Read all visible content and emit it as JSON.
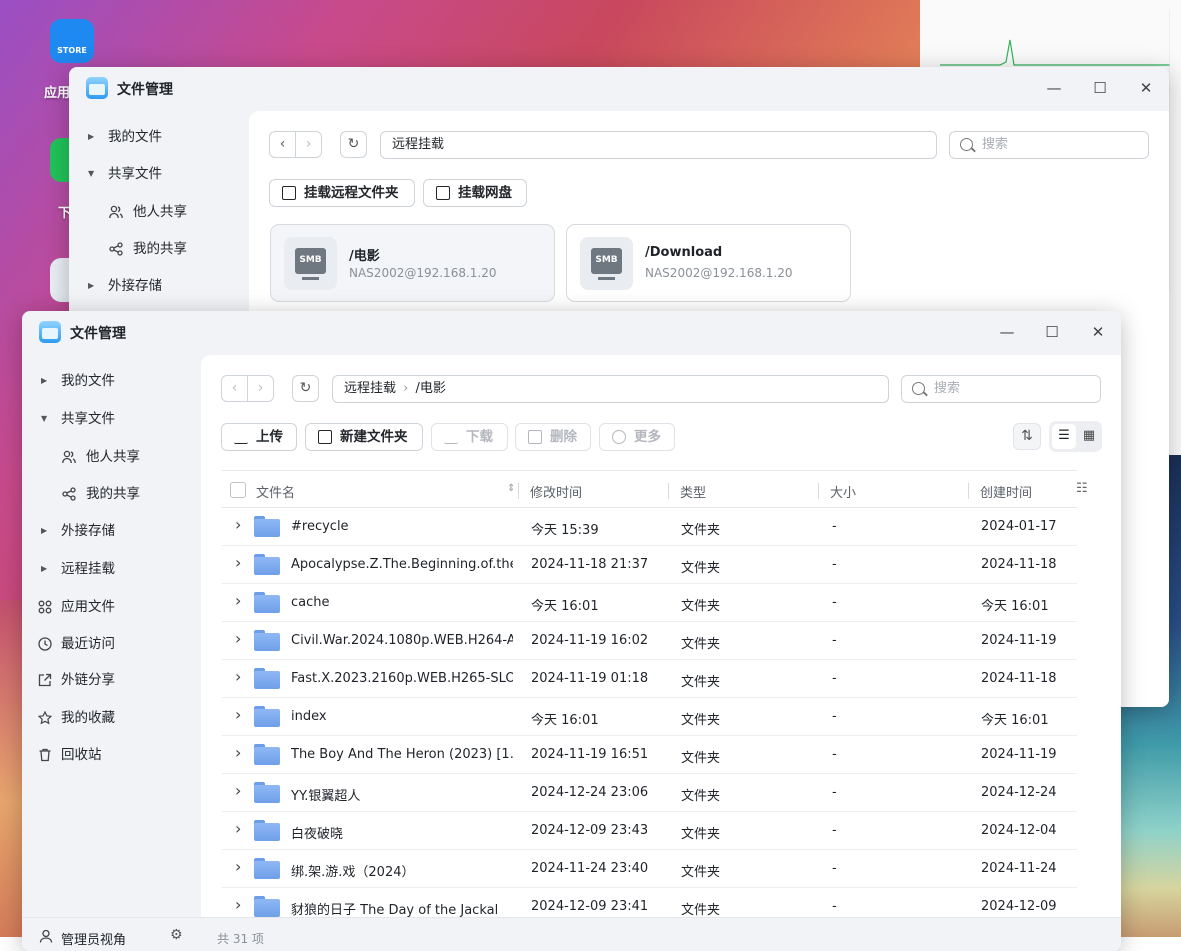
{
  "desktop": {
    "store_icon_text": "STORE",
    "label_apps": "应用",
    "label_download": "下"
  },
  "back_window": {
    "title": "文件管理",
    "sidebar": [
      {
        "label": "我的文件",
        "type": "top"
      },
      {
        "label": "共享文件",
        "type": "top"
      },
      {
        "label": "他人共享",
        "type": "sub"
      },
      {
        "label": "我的共享",
        "type": "sub"
      },
      {
        "label": "外接存储",
        "type": "top"
      }
    ],
    "address": "远程挂载",
    "search_placeholder": "搜索",
    "buttons": {
      "mount_folder": "挂载远程文件夹",
      "mount_disk": "挂载网盘"
    },
    "cards": [
      {
        "icon_text": "SMB",
        "name": "/电影",
        "host": "NAS2002@192.168.1.20"
      },
      {
        "icon_text": "SMB",
        "name": "/Download",
        "host": "NAS2002@192.168.1.20"
      }
    ]
  },
  "front_window": {
    "title": "文件管理",
    "sidebar": [
      {
        "label": "我的文件"
      },
      {
        "label": "共享文件"
      },
      {
        "label": "他人共享"
      },
      {
        "label": "我的共享"
      },
      {
        "label": "外接存储"
      },
      {
        "label": "远程挂载"
      },
      {
        "label": "应用文件"
      },
      {
        "label": "最近访问"
      },
      {
        "label": "外链分享"
      },
      {
        "label": "我的收藏"
      },
      {
        "label": "回收站"
      }
    ],
    "breadcrumb": [
      "远程挂载",
      "/电影"
    ],
    "search_placeholder": "搜索",
    "toolbar": {
      "upload": "上传",
      "new_folder": "新建文件夹",
      "download": "下载",
      "delete": "删除",
      "more": "更多"
    },
    "columns": {
      "name": "文件名",
      "modified": "修改时间",
      "type": "类型",
      "size": "大小",
      "created": "创建时间"
    },
    "rows": [
      {
        "name": "#recycle",
        "modified": "今天 15:39",
        "type": "文件夹",
        "size": "-",
        "created": "2024-01-17"
      },
      {
        "name": "Apocalypse.Z.The.Beginning.of.the...",
        "modified": "2024-11-18 21:37",
        "type": "文件夹",
        "size": "-",
        "created": "2024-11-18"
      },
      {
        "name": "cache",
        "modified": "今天 16:01",
        "type": "文件夹",
        "size": "-",
        "created": "今天 16:01"
      },
      {
        "name": "Civil.War.2024.1080p.WEB.H264-A...",
        "modified": "2024-11-19 16:02",
        "type": "文件夹",
        "size": "-",
        "created": "2024-11-19"
      },
      {
        "name": "Fast.X.2023.2160p.WEB.H265-SLO...",
        "modified": "2024-11-19 01:18",
        "type": "文件夹",
        "size": "-",
        "created": "2024-11-18"
      },
      {
        "name": "index",
        "modified": "今天 16:01",
        "type": "文件夹",
        "size": "-",
        "created": "今天 16:01"
      },
      {
        "name": "The Boy And The Heron (2023) [1...",
        "modified": "2024-11-19 16:51",
        "type": "文件夹",
        "size": "-",
        "created": "2024-11-19"
      },
      {
        "name": "YY.银翼超人",
        "modified": "2024-12-24 23:06",
        "type": "文件夹",
        "size": "-",
        "created": "2024-12-24"
      },
      {
        "name": "白夜破晓",
        "modified": "2024-12-09 23:43",
        "type": "文件夹",
        "size": "-",
        "created": "2024-12-04"
      },
      {
        "name": "绑.架.游.戏（2024）",
        "modified": "2024-11-24 23:40",
        "type": "文件夹",
        "size": "-",
        "created": "2024-11-24"
      },
      {
        "name": "豺狼的日子 The Day of the Jackal",
        "modified": "2024-12-09 23:41",
        "type": "文件夹",
        "size": "-",
        "created": "2024-12-09"
      }
    ],
    "footer": {
      "admin_view": "管理员视角",
      "count": "共 31 项"
    }
  },
  "colors": {
    "accent": "#2f7cf6",
    "folder": "#7aa7ee"
  }
}
